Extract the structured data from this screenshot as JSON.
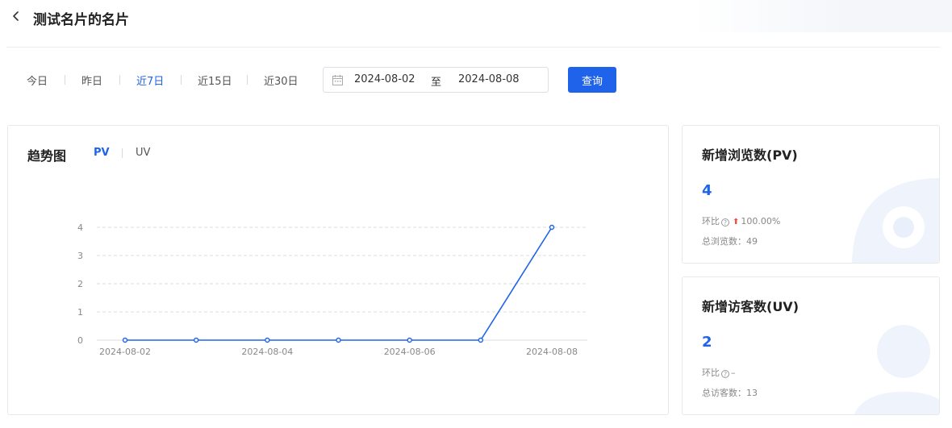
{
  "header": {
    "title": "测试名片的名片"
  },
  "filters": {
    "ranges": [
      "今日",
      "昨日",
      "近7日",
      "近15日",
      "近30日"
    ],
    "active_range": "近7日",
    "start_date": "2024-08-02",
    "range_separator": "至",
    "end_date": "2024-08-08",
    "query_label": "查询"
  },
  "trend": {
    "title": "趋势图",
    "tabs": [
      "PV",
      "UV"
    ],
    "active_tab": "PV"
  },
  "chart_data": {
    "type": "line",
    "x": [
      "2024-08-02",
      "2024-08-03",
      "2024-08-04",
      "2024-08-05",
      "2024-08-06",
      "2024-08-07",
      "2024-08-08"
    ],
    "xtick_labels": [
      "2024-08-02",
      "2024-08-04",
      "2024-08-06",
      "2024-08-08"
    ],
    "series": [
      {
        "values": [
          0,
          0,
          0,
          0,
          0,
          0,
          4
        ]
      }
    ],
    "ylim": [
      0,
      4
    ],
    "yticks": [
      0,
      1,
      2,
      3,
      4
    ],
    "grid": true,
    "color": "#1e63e9"
  },
  "stats": {
    "pv": {
      "title": "新增浏览数(PV)",
      "value": "4",
      "compare_label": "环比",
      "compare_value": "100.00%",
      "trend": "up",
      "total_label": "总浏览数：",
      "total_value": "49"
    },
    "uv": {
      "title": "新增访客数(UV)",
      "value": "2",
      "compare_label": "环比",
      "compare_value": "–",
      "total_label": "总访客数：",
      "total_value": "13"
    }
  },
  "colors": {
    "accent": "#1e63e9",
    "up": "#f04b3c",
    "grid": "#dddddd"
  }
}
